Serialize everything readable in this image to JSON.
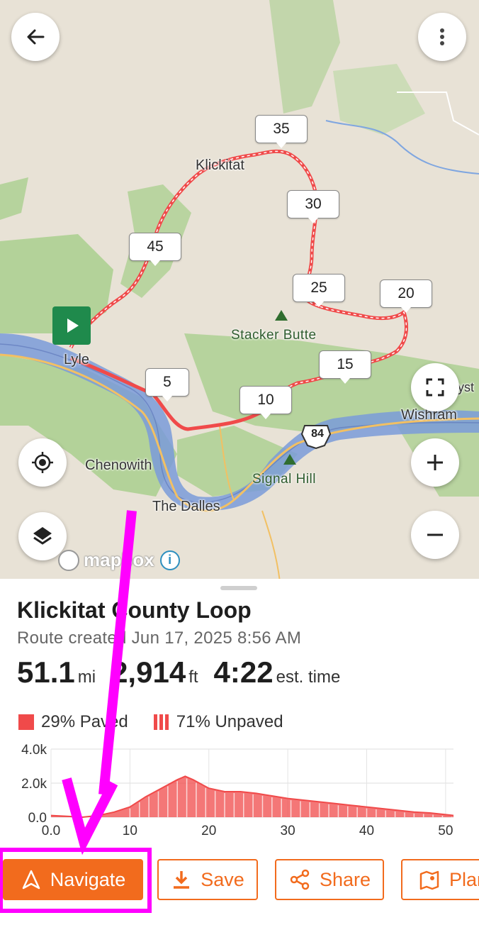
{
  "map": {
    "labels": {
      "klickitat": "Klickitat",
      "lyle": "Lyle",
      "chenowith": "Chenowith",
      "the_dalles": "The Dalles",
      "wishram": "Wishram",
      "stacker_butte": "Stacker Butte",
      "signal_hill": "Signal Hill",
      "highway": "84",
      "edge_label": "yst"
    },
    "mile_markers": [
      "35",
      "30",
      "45",
      "25",
      "20",
      "15",
      "5",
      "10"
    ],
    "attribution": "mapbox",
    "colors": {
      "route": "#f04a4a",
      "water": "#7a9bd9",
      "forest": "#a9cf8e",
      "land": "#e8e2d6",
      "start": "#1f8a4c"
    },
    "icons": [
      "back-arrow-icon",
      "more-vert-icon",
      "play-icon",
      "fullscreen-icon",
      "my-location-icon",
      "plus-icon",
      "layers-icon",
      "minus-icon",
      "info-icon"
    ]
  },
  "route": {
    "title": "Klickitat County Loop",
    "subtitle": "Route created Jun 17, 2025 8:56 AM",
    "distance_value": "51.1",
    "distance_unit": "mi",
    "elevation_value": "2,914",
    "elevation_unit": "ft",
    "time_value": "4:22",
    "time_unit": "est. time"
  },
  "surface_legend": {
    "paved": "29% Paved",
    "unpaved": "71% Unpaved"
  },
  "chart_data": {
    "type": "area",
    "title": "",
    "xlabel": "",
    "ylabel": "",
    "xlim": [
      0,
      51
    ],
    "ylim": [
      0,
      4000
    ],
    "x_ticks": [
      "0.0",
      "10",
      "20",
      "30",
      "40",
      "50"
    ],
    "y_ticks": [
      "4.0k",
      "2.0k",
      "0.0"
    ],
    "x": [
      0,
      2,
      4,
      6,
      8,
      10,
      12,
      14,
      16,
      17,
      18,
      20,
      22,
      24,
      26,
      28,
      30,
      32,
      34,
      36,
      38,
      40,
      42,
      44,
      46,
      48,
      50,
      51
    ],
    "series": [
      {
        "values": [
          100,
          50,
          0,
          100,
          300,
          600,
          1200,
          1700,
          2200,
          2400,
          2200,
          1700,
          1500,
          1500,
          1400,
          1250,
          1100,
          1000,
          900,
          800,
          700,
          600,
          500,
          400,
          300,
          250,
          150,
          100
        ]
      }
    ],
    "grid": true,
    "color": "#f04a4a"
  },
  "actions": {
    "navigate": "Navigate",
    "save": "Save",
    "share": "Share",
    "plan": "Plan"
  },
  "annotation": {
    "color": "#ff00ff"
  }
}
